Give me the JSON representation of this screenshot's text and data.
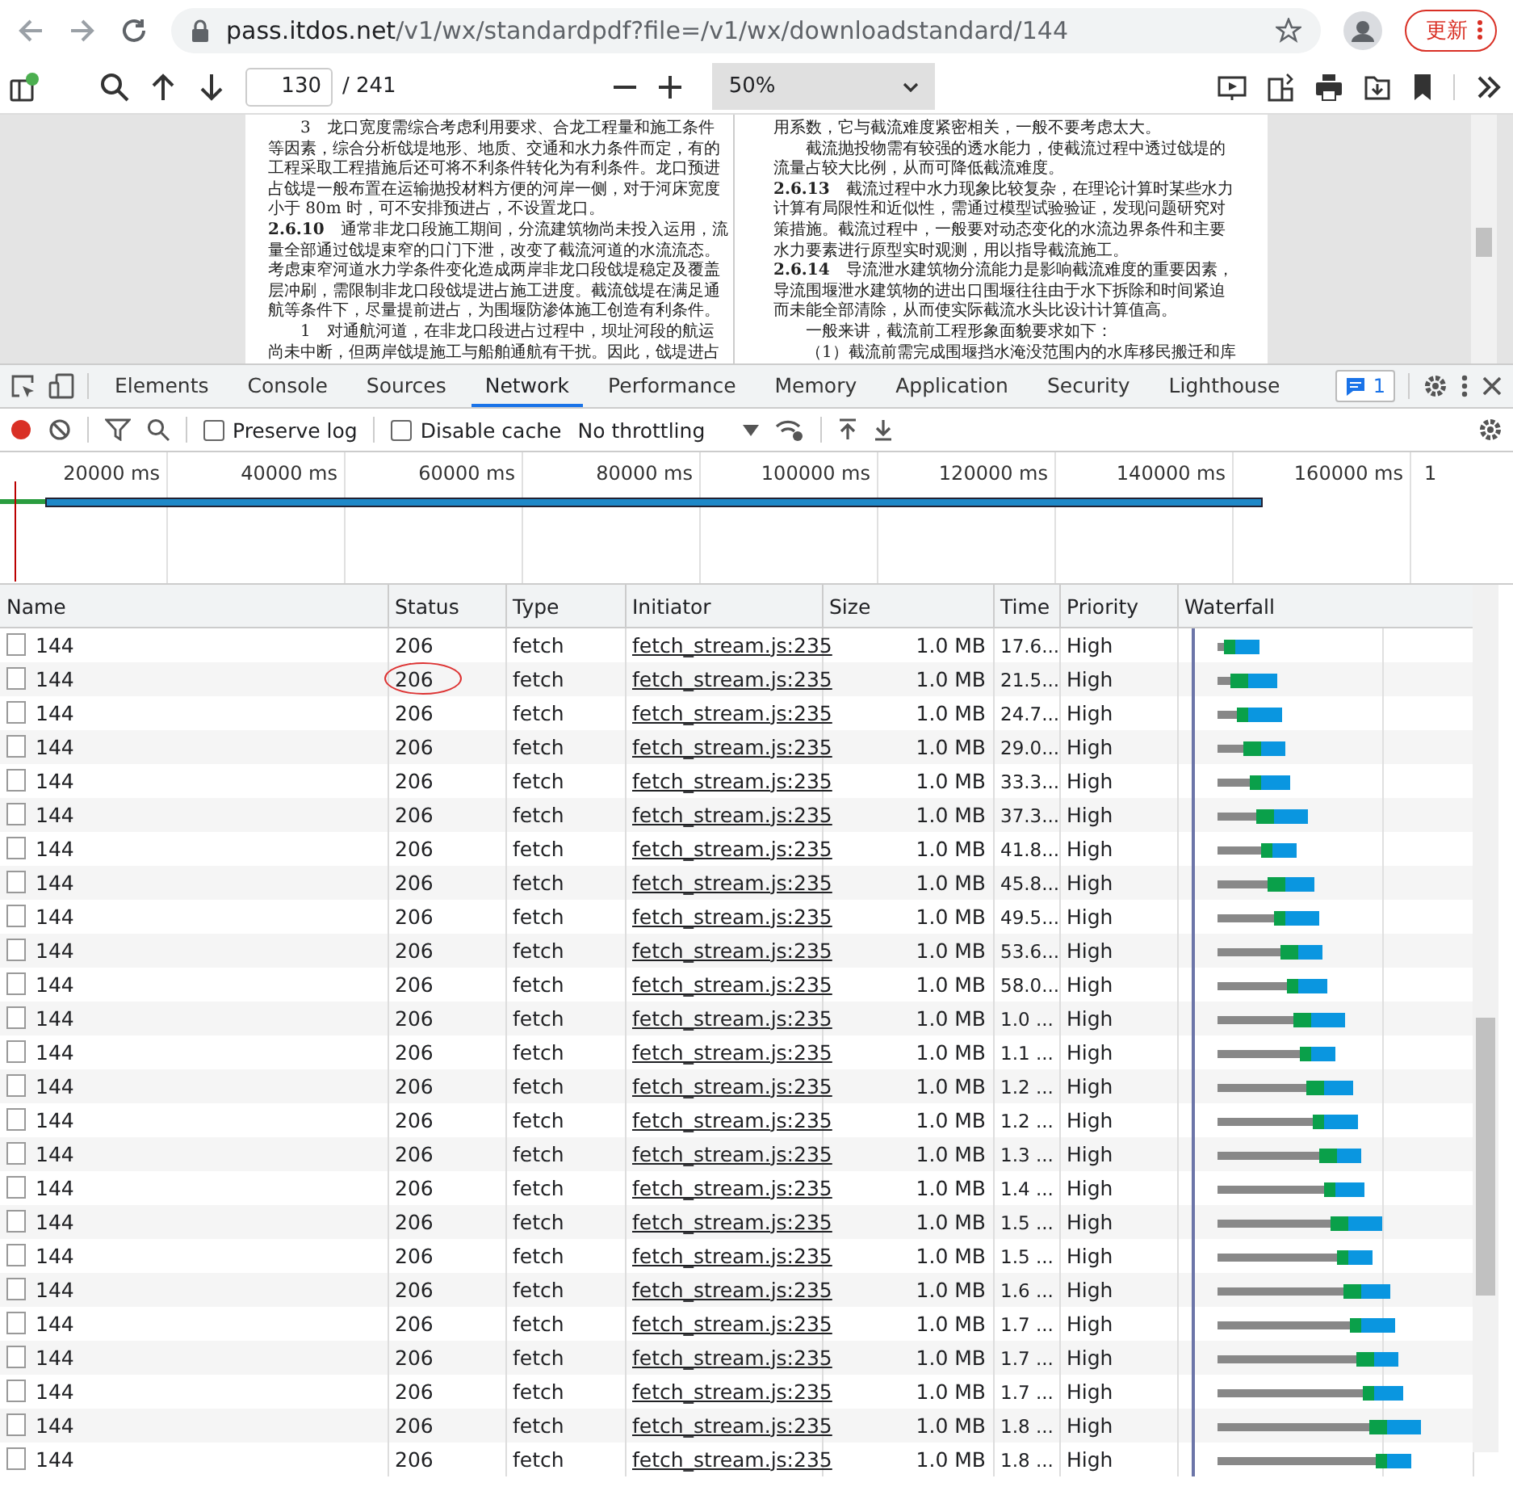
{
  "browser": {
    "url_host": "pass.itdos.net",
    "url_path": "/v1/wx/standardpdf?file=/v1/wx/downloadstandard/144",
    "update_button": "更新"
  },
  "pdf_toolbar": {
    "page": "130",
    "page_count": "/ 241",
    "zoom": "50%"
  },
  "pdf_pages": [
    {
      "lines": [
        {
          "text": "3　龙口宽度需综合考虑利用要求、合龙工程量和施工条件",
          "indent": true
        },
        {
          "text": "等因素，综合分析戗堤地形、地质、交通和水力条件而定，有的",
          "indent": false
        },
        {
          "text": "工程采取工程措施后还可将不利条件转化为有利条件。龙口预进",
          "indent": false
        },
        {
          "text": "占戗堤一般布置在运输抛投材料方便的河岸一侧，对于河床宽度",
          "indent": false
        },
        {
          "text": "小于 80m 时，可不安排预进占，不设置龙口。",
          "indent": false
        },
        {
          "text": "**2.6.10**　通常非龙口段施工期间，分流建筑物尚未投入运用，流",
          "indent": false
        },
        {
          "text": "量全部通过戗堤束窄的口门下泄，改变了截流河道的水流流态。",
          "indent": false
        },
        {
          "text": "考虑束窄河道水力学条件变化造成两岸非龙口段戗堤稳定及覆盖",
          "indent": false
        },
        {
          "text": "层冲刷，需限制非龙口段戗堤进占施工进度。截流戗堤在满足通",
          "indent": false
        },
        {
          "text": "航等条件下，尽量提前进占，为围堰防渗体施工创造有利条件。",
          "indent": false
        },
        {
          "text": "1　对通航河道，在非龙口段进占过程中，坝址河段的航运",
          "indent": true
        },
        {
          "text": "尚未中断，但两岸戗堤施工与船舶通航有干扰。因此，戗堤进占",
          "indent": false
        }
      ]
    },
    {
      "lines": [
        {
          "text": "用系数，它与截流难度紧密相关，一般不要考虑太大。",
          "indent": false
        },
        {
          "text": "截流抛投物需有较强的透水能力，使截流过程中透过戗堤的",
          "indent": true
        },
        {
          "text": "流量占较大比例，从而可降低截流难度。",
          "indent": false
        },
        {
          "text": "**2.6.13**　截流过程中水力现象比较复杂，在理论计算时某些水力",
          "indent": false
        },
        {
          "text": "计算有局限性和近似性，需通过模型试验验证，发现问题研究对",
          "indent": false
        },
        {
          "text": "策措施。截流过程中，一般要对动态变化的水流边界条件和主要",
          "indent": false
        },
        {
          "text": "水力要素进行原型实时观测，用以指导截流施工。",
          "indent": false
        },
        {
          "text": "**2.6.14**　导流泄水建筑物分流能力是影响截流难度的重要因素，",
          "indent": false
        },
        {
          "text": "导流围堰泄水建筑物的进出口围堰往往由于水下拆除和时间紧迫",
          "indent": false
        },
        {
          "text": "而未能全部清除，从而使实际截流水头比设计计算值高。",
          "indent": false
        },
        {
          "text": "一般来讲，截流前工程形象面貌要求如下：",
          "indent": true
        },
        {
          "text": "（1）截流前需完成围堰挡水淹没范围内的水库移民搬迁和库",
          "indent": true
        }
      ]
    }
  ],
  "devtools": {
    "tabs": [
      {
        "label": "Elements",
        "selected": false
      },
      {
        "label": "Console",
        "selected": false
      },
      {
        "label": "Sources",
        "selected": false
      },
      {
        "label": "Network",
        "selected": true
      },
      {
        "label": "Performance",
        "selected": false
      },
      {
        "label": "Memory",
        "selected": false
      },
      {
        "label": "Application",
        "selected": false
      },
      {
        "label": "Security",
        "selected": false
      },
      {
        "label": "Lighthouse",
        "selected": false
      }
    ],
    "issues_count": "1",
    "toolbar": {
      "preserve_log": {
        "label": "Preserve log",
        "checked": false
      },
      "disable_cache": {
        "label": "Disable cache",
        "checked": false
      },
      "throttling": "No throttling"
    },
    "overview_ticks": [
      "20000 ms",
      "40000 ms",
      "60000 ms",
      "80000 ms",
      "100000 ms",
      "120000 ms",
      "140000 ms",
      "160000 ms",
      "1"
    ],
    "columns": [
      "Name",
      "Status",
      "Type",
      "Initiator",
      "Size",
      "Time",
      "Priority",
      "Waterfall"
    ],
    "rows": [
      {
        "name": "144",
        "status": "206",
        "type": "fetch",
        "initiator": "fetch_stream.js:235",
        "size": "1.0 MB",
        "time": "17.6...",
        "priority": "High",
        "circled": false
      },
      {
        "name": "144",
        "status": "206",
        "type": "fetch",
        "initiator": "fetch_stream.js:235",
        "size": "1.0 MB",
        "time": "21.5...",
        "priority": "High",
        "circled": true
      },
      {
        "name": "144",
        "status": "206",
        "type": "fetch",
        "initiator": "fetch_stream.js:235",
        "size": "1.0 MB",
        "time": "24.7...",
        "priority": "High",
        "circled": false
      },
      {
        "name": "144",
        "status": "206",
        "type": "fetch",
        "initiator": "fetch_stream.js:235",
        "size": "1.0 MB",
        "time": "29.0...",
        "priority": "High",
        "circled": false
      },
      {
        "name": "144",
        "status": "206",
        "type": "fetch",
        "initiator": "fetch_stream.js:235",
        "size": "1.0 MB",
        "time": "33.3...",
        "priority": "High",
        "circled": false
      },
      {
        "name": "144",
        "status": "206",
        "type": "fetch",
        "initiator": "fetch_stream.js:235",
        "size": "1.0 MB",
        "time": "37.3...",
        "priority": "High",
        "circled": false
      },
      {
        "name": "144",
        "status": "206",
        "type": "fetch",
        "initiator": "fetch_stream.js:235",
        "size": "1.0 MB",
        "time": "41.8...",
        "priority": "High",
        "circled": false
      },
      {
        "name": "144",
        "status": "206",
        "type": "fetch",
        "initiator": "fetch_stream.js:235",
        "size": "1.0 MB",
        "time": "45.8...",
        "priority": "High",
        "circled": false
      },
      {
        "name": "144",
        "status": "206",
        "type": "fetch",
        "initiator": "fetch_stream.js:235",
        "size": "1.0 MB",
        "time": "49.5...",
        "priority": "High",
        "circled": false
      },
      {
        "name": "144",
        "status": "206",
        "type": "fetch",
        "initiator": "fetch_stream.js:235",
        "size": "1.0 MB",
        "time": "53.6...",
        "priority": "High",
        "circled": false
      },
      {
        "name": "144",
        "status": "206",
        "type": "fetch",
        "initiator": "fetch_stream.js:235",
        "size": "1.0 MB",
        "time": "58.0...",
        "priority": "High",
        "circled": false
      },
      {
        "name": "144",
        "status": "206",
        "type": "fetch",
        "initiator": "fetch_stream.js:235",
        "size": "1.0 MB",
        "time": "1.0 ...",
        "priority": "High",
        "circled": false
      },
      {
        "name": "144",
        "status": "206",
        "type": "fetch",
        "initiator": "fetch_stream.js:235",
        "size": "1.0 MB",
        "time": "1.1 ...",
        "priority": "High",
        "circled": false
      },
      {
        "name": "144",
        "status": "206",
        "type": "fetch",
        "initiator": "fetch_stream.js:235",
        "size": "1.0 MB",
        "time": "1.2 ...",
        "priority": "High",
        "circled": false
      },
      {
        "name": "144",
        "status": "206",
        "type": "fetch",
        "initiator": "fetch_stream.js:235",
        "size": "1.0 MB",
        "time": "1.2 ...",
        "priority": "High",
        "circled": false
      },
      {
        "name": "144",
        "status": "206",
        "type": "fetch",
        "initiator": "fetch_stream.js:235",
        "size": "1.0 MB",
        "time": "1.3 ...",
        "priority": "High",
        "circled": false
      },
      {
        "name": "144",
        "status": "206",
        "type": "fetch",
        "initiator": "fetch_stream.js:235",
        "size": "1.0 MB",
        "time": "1.4 ...",
        "priority": "High",
        "circled": false
      },
      {
        "name": "144",
        "status": "206",
        "type": "fetch",
        "initiator": "fetch_stream.js:235",
        "size": "1.0 MB",
        "time": "1.5 ...",
        "priority": "High",
        "circled": false
      },
      {
        "name": "144",
        "status": "206",
        "type": "fetch",
        "initiator": "fetch_stream.js:235",
        "size": "1.0 MB",
        "time": "1.5 ...",
        "priority": "High",
        "circled": false
      },
      {
        "name": "144",
        "status": "206",
        "type": "fetch",
        "initiator": "fetch_stream.js:235",
        "size": "1.0 MB",
        "time": "1.6 ...",
        "priority": "High",
        "circled": false
      },
      {
        "name": "144",
        "status": "206",
        "type": "fetch",
        "initiator": "fetch_stream.js:235",
        "size": "1.0 MB",
        "time": "1.7 ...",
        "priority": "High",
        "circled": false
      },
      {
        "name": "144",
        "status": "206",
        "type": "fetch",
        "initiator": "fetch_stream.js:235",
        "size": "1.0 MB",
        "time": "1.7 ...",
        "priority": "High",
        "circled": false
      },
      {
        "name": "144",
        "status": "206",
        "type": "fetch",
        "initiator": "fetch_stream.js:235",
        "size": "1.0 MB",
        "time": "1.7 ...",
        "priority": "High",
        "circled": false
      },
      {
        "name": "144",
        "status": "206",
        "type": "fetch",
        "initiator": "fetch_stream.js:235",
        "size": "1.0 MB",
        "time": "1.8 ...",
        "priority": "High",
        "circled": false
      },
      {
        "name": "144",
        "status": "206",
        "type": "fetch",
        "initiator": "fetch_stream.js:235",
        "size": "1.0 MB",
        "time": "1.8 ...",
        "priority": "High",
        "circled": false
      }
    ]
  }
}
